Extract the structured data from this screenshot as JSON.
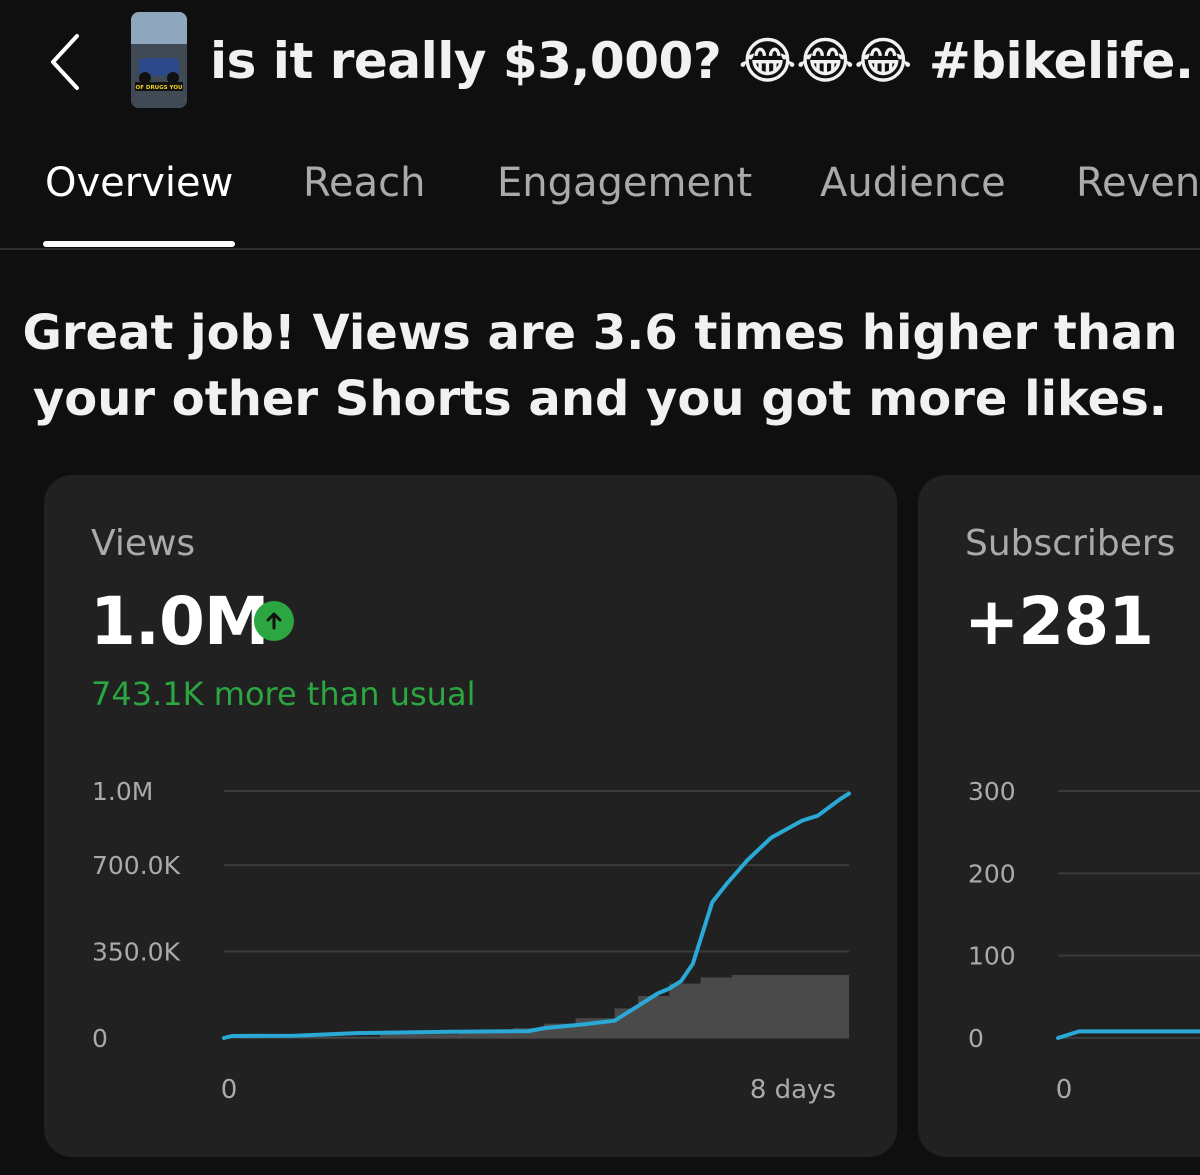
{
  "header": {
    "title": "is it really $3,000? 😂😂😂 #bikelife...",
    "thumbnail_caption": "OF DRUGS YOU"
  },
  "tabs": [
    {
      "label": "Overview",
      "active": true
    },
    {
      "label": "Reach"
    },
    {
      "label": "Engagement"
    },
    {
      "label": "Audience"
    },
    {
      "label": "Reven"
    }
  ],
  "headline": {
    "line1": "Great job! Views are 3.6 times higher than",
    "line2": "your other Shorts and you got more likes."
  },
  "views_card": {
    "label": "Views",
    "value": "1.0M",
    "delta": "743.1K more than usual",
    "trend_icon": "arrow-up-icon",
    "positive_color": "#2ba640"
  },
  "subscribers_card": {
    "label": "Subscribers",
    "value": "+281"
  },
  "colors": {
    "line": "#2aa8d6",
    "typical_area": "#4a4a4a",
    "card_bg": "#212121"
  },
  "chart_data": [
    {
      "type": "line",
      "y_tick_labels": [
        "1.0M",
        "700.0K",
        "350.0K",
        "0"
      ],
      "y_ticks": [
        1000000,
        700000,
        350000,
        0
      ],
      "x_tick_labels": [
        "0",
        "8 days"
      ],
      "xlim": [
        0,
        8
      ],
      "ylim": [
        0,
        1000000
      ],
      "grid": true,
      "series": [
        {
          "role": "this_short",
          "x": [
            0,
            0.1,
            0.9,
            1.7,
            2.9,
            3.9,
            4.1,
            4.6,
            5.0,
            5.3,
            5.55,
            5.7,
            5.85,
            6.0,
            6.15,
            6.25,
            6.45,
            6.7,
            7.0,
            7.4,
            7.6,
            7.9,
            8.0
          ],
          "values": [
            0,
            8000,
            9000,
            20000,
            25000,
            28000,
            40000,
            55000,
            70000,
            130000,
            180000,
            200000,
            230000,
            300000,
            450000,
            550000,
            630000,
            720000,
            810000,
            880000,
            900000,
            970000,
            990000
          ]
        },
        {
          "role": "typical_range",
          "x": [
            0,
            1,
            2,
            3,
            3.7,
            4.1,
            4.5,
            5.0,
            5.3,
            5.7,
            6.1,
            6.5,
            7.0,
            8.0
          ],
          "values": [
            0,
            5000,
            15000,
            28000,
            40000,
            58000,
            80000,
            120000,
            170000,
            220000,
            245000,
            255000,
            255000,
            255000
          ]
        }
      ]
    },
    {
      "type": "line",
      "y_tick_labels": [
        "300",
        "200",
        "100",
        "0"
      ],
      "y_ticks": [
        300,
        200,
        100,
        0
      ],
      "x_tick_labels": [
        "0"
      ],
      "ylim": [
        0,
        300
      ],
      "grid": true,
      "series": [
        {
          "role": "this_short",
          "x": [
            0,
            0.15,
            0.5,
            2.0
          ],
          "values": [
            0,
            8,
            8,
            8
          ]
        }
      ]
    }
  ]
}
